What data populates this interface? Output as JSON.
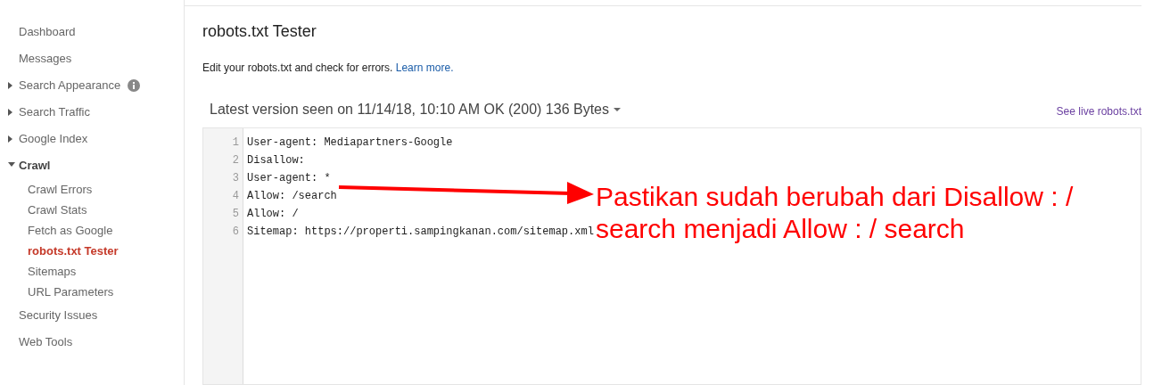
{
  "sidebar": {
    "items": [
      {
        "label": "Dashboard",
        "kind": "link",
        "selected": false
      },
      {
        "label": "Messages",
        "kind": "link",
        "selected": false
      },
      {
        "label": "Search Appearance",
        "kind": "group",
        "expanded": false,
        "info": true,
        "selected": false
      },
      {
        "label": "Search Traffic",
        "kind": "group",
        "expanded": false,
        "selected": false
      },
      {
        "label": "Google Index",
        "kind": "group",
        "expanded": false,
        "selected": false
      },
      {
        "label": "Crawl",
        "kind": "group",
        "expanded": true,
        "selected": false,
        "children": [
          {
            "label": "Crawl Errors",
            "selected": false
          },
          {
            "label": "Crawl Stats",
            "selected": false
          },
          {
            "label": "Fetch as Google",
            "selected": false
          },
          {
            "label": "robots.txt Tester",
            "selected": true
          },
          {
            "label": "Sitemaps",
            "selected": false
          },
          {
            "label": "URL Parameters",
            "selected": false
          }
        ]
      },
      {
        "label": "Security Issues",
        "kind": "link",
        "selected": false
      },
      {
        "label": "Web Tools",
        "kind": "link",
        "selected": false
      }
    ]
  },
  "page": {
    "title": "robots.txt Tester",
    "description": "Edit your robots.txt and check for errors.",
    "learn_more": "Learn more.",
    "version": "Latest version seen on 11/14/18, 10:10 AM OK (200) 136 Bytes",
    "live_link": "See live robots.txt"
  },
  "editor": {
    "lines": [
      {
        "number": "1",
        "text": "User-agent: Mediapartners-Google"
      },
      {
        "number": "2",
        "text": "Disallow:"
      },
      {
        "number": "3",
        "text": "User-agent: *"
      },
      {
        "number": "4",
        "text": "Allow: /search"
      },
      {
        "number": "5",
        "text": "Allow: /"
      },
      {
        "number": "6",
        "text": "Sitemap: https://properti.sampingkanan.com/sitemap.xml"
      }
    ]
  },
  "annotation": {
    "text": "Pastikan sudah berubah dari Disallow : / search menjadi Allow : / search"
  }
}
